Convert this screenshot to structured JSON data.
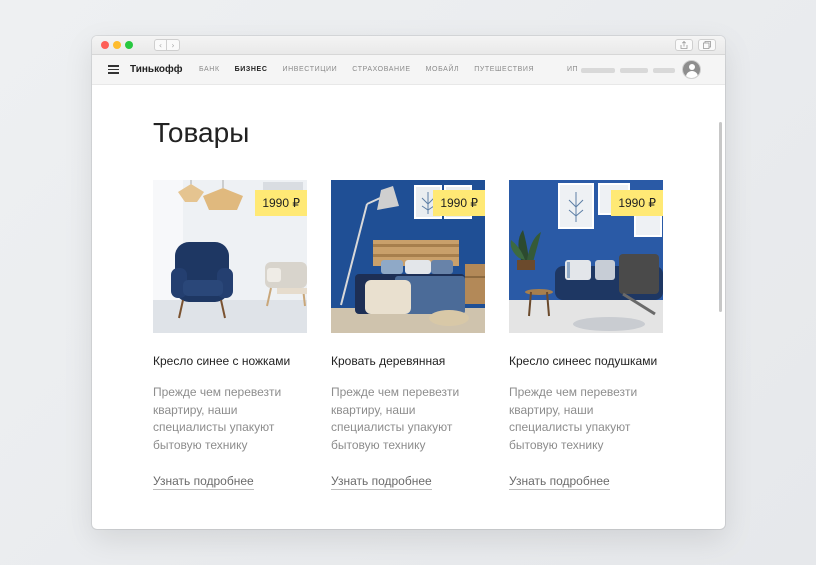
{
  "browser": {
    "back_icon": "‹",
    "forward_icon": "›"
  },
  "header": {
    "brand": "Тинькофф",
    "menu": [
      {
        "label": "Банк",
        "active": false
      },
      {
        "label": "Бизнес",
        "active": true
      },
      {
        "label": "Инвестиции",
        "active": false
      },
      {
        "label": "Страхование",
        "active": false
      },
      {
        "label": "Мобайл",
        "active": false
      },
      {
        "label": "Путешествия",
        "active": false
      }
    ],
    "user_prefix": "ИП"
  },
  "page": {
    "title": "Товары"
  },
  "products": [
    {
      "title": "Кресло синее с ножками",
      "price": "1990 ₽",
      "description": "Прежде чем перевезти квартиру, наши специалисты упакуют бытовую технику",
      "link": "Узнать подробнее"
    },
    {
      "title": "Кровать деревянная",
      "price": "1990 ₽",
      "description": "Прежде чем перевезти квартиру, наши специалисты упакуют бытовую технику",
      "link": "Узнать подробнее"
    },
    {
      "title": "Кресло синеес подушками",
      "price": "1990 ₽",
      "description": "Прежде чем перевезти квартиру, наши специалисты упакуют бытовую технику",
      "link": "Узнать подробнее"
    }
  ],
  "colors": {
    "price_badge": "#ffe975",
    "accent_blue": "#1f4f95",
    "navy_furniture": "#1e3763"
  }
}
